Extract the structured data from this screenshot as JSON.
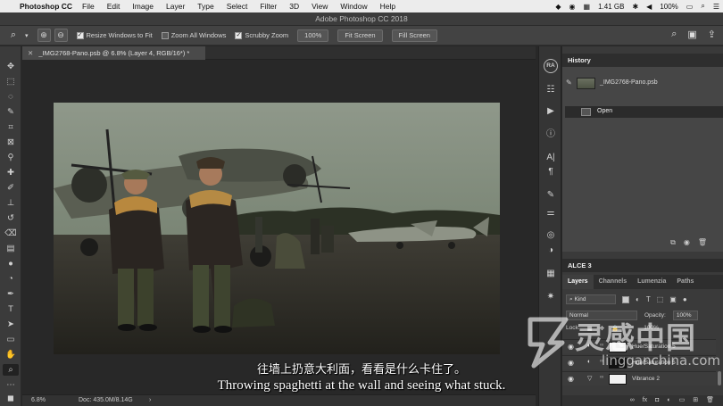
{
  "menubar": {
    "app": "Photoshop CC",
    "items": [
      "File",
      "Edit",
      "Image",
      "Layer",
      "Type",
      "Select",
      "Filter",
      "3D",
      "View",
      "Window",
      "Help"
    ],
    "memory": "1.41 GB",
    "battery": "100%"
  },
  "window": {
    "title": "Adobe Photoshop CC 2018"
  },
  "options": {
    "resize_windows": "Resize Windows to Fit",
    "zoom_all": "Zoom All Windows",
    "scrubby": "Scrubby Zoom",
    "zoom_value": "100%",
    "fit_screen": "Fit Screen",
    "fill_screen": "Fill Screen"
  },
  "document": {
    "tab_label": "_IMG2768-Pano.psb @ 6.8% (Layer 4, RGB/16*) *",
    "zoom": "6.8%",
    "doc_size": "Doc: 435.0M/8.14G"
  },
  "subtitles": {
    "chinese": "往墙上扔意大利面，看看是什么卡住了。",
    "english": "Throwing spaghetti at the wall and seeing what stuck."
  },
  "dock": {
    "ra_label": "RA"
  },
  "history": {
    "title": "History",
    "snapshot": "_IMG2768-Pano.psb",
    "states": [
      "Open"
    ]
  },
  "libraries": {
    "title": "ALCE 3"
  },
  "layers": {
    "tabs": [
      "Layers",
      "Channels",
      "Lumenzia",
      "Paths"
    ],
    "filter_kind": "Kind",
    "blend_mode": "Normal",
    "opacity_label": "Opacity:",
    "opacity_value": "100%",
    "lock_label": "Lock:",
    "fill_value": "100%",
    "rows": [
      {
        "name": "Hue/Saturation 5"
      },
      {
        "name": "Hue/Saturation 5"
      },
      {
        "name": "Vibrance 2"
      }
    ]
  },
  "watermark": {
    "chinese": "灵感中国",
    "english": "lingganchina.com"
  },
  "colors": {
    "menubar": "#ececec",
    "panel": "#3a3a3a",
    "canvas": "#282828",
    "accent": "#1473e6"
  }
}
